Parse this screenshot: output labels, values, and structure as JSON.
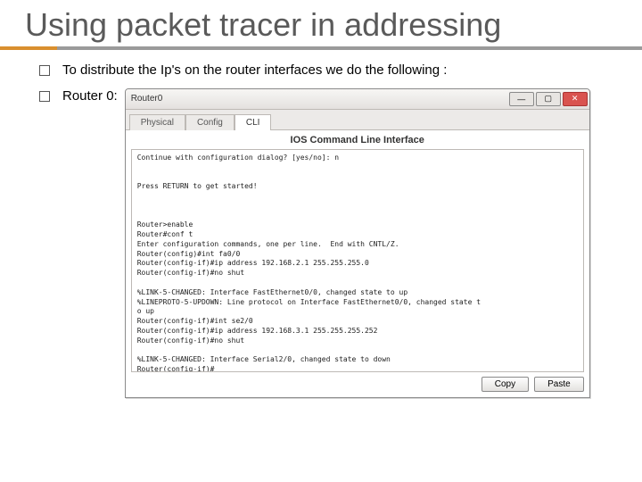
{
  "title": "Using packet tracer in addressing",
  "bullets": {
    "b1": "To distribute the Ip's on the router interfaces we do the following :",
    "b2": "Router 0:"
  },
  "ptwin": {
    "title": "Router0",
    "minimize": "—",
    "maximize": "▢",
    "close": "✕",
    "tabs": {
      "physical": "Physical",
      "config": "Config",
      "cli": "CLI"
    },
    "subtitle": "IOS Command Line Interface",
    "buttons": {
      "copy": "Copy",
      "paste": "Paste"
    }
  },
  "cli_text": "Continue with configuration dialog? [yes/no]: n\n\n\nPress RETURN to get started!\n\n\n\nRouter>enable\nRouter#conf t\nEnter configuration commands, one per line.  End with CNTL/Z.\nRouter(config)#int fa0/0\nRouter(config-if)#ip address 192.168.2.1 255.255.255.0\nRouter(config-if)#no shut\n\n%LINK-5-CHANGED: Interface FastEthernet0/0, changed state to up\n%LINEPROTO-5-UPDOWN: Line protocol on Interface FastEthernet0/0, changed state t\no up\nRouter(config-if)#int se2/0\nRouter(config-if)#ip address 192.168.3.1 255.255.255.252\nRouter(config-if)#no shut\n\n%LINK-5-CHANGED: Interface Serial2/0, changed state to down\nRouter(config-if)#"
}
